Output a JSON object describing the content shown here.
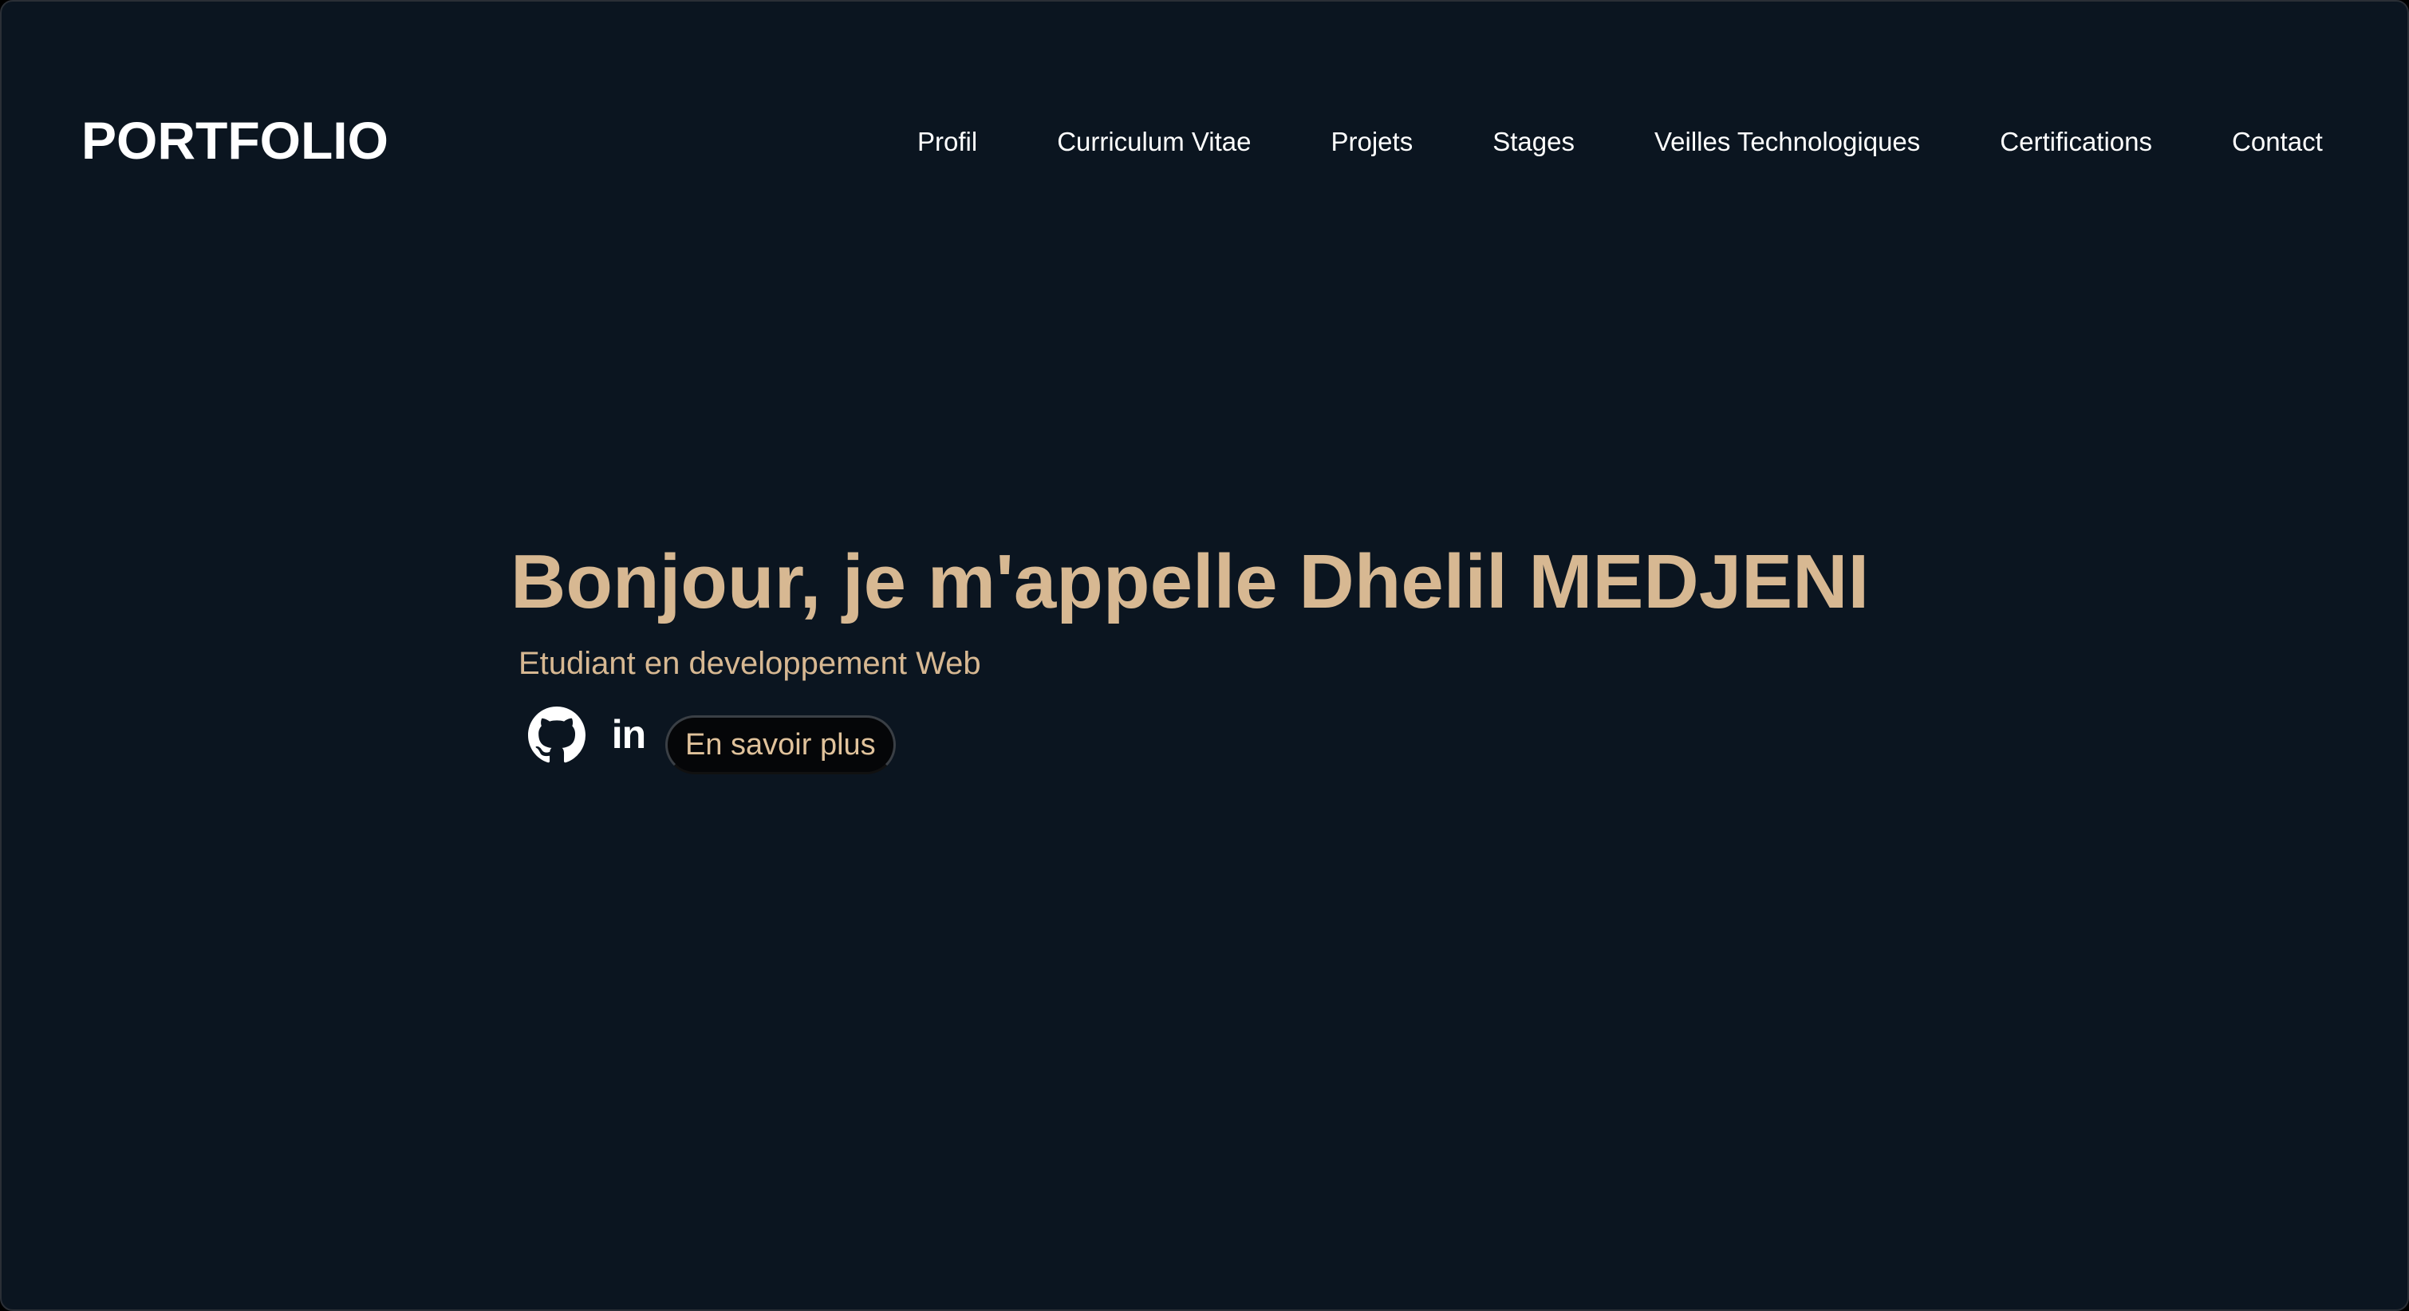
{
  "header": {
    "brand": "PORTFOLIO",
    "nav": [
      {
        "label": "Profil"
      },
      {
        "label": "Curriculum Vitae"
      },
      {
        "label": "Projets"
      },
      {
        "label": "Stages"
      },
      {
        "label": "Veilles Technologiques"
      },
      {
        "label": "Certifications"
      },
      {
        "label": "Contact"
      }
    ]
  },
  "hero": {
    "title": "Bonjour, je m'appelle Dhelil MEDJENI",
    "subtitle": "Etudiant en developpement Web",
    "linkedin_glyph": "in",
    "cta_label": "En savoir plus"
  },
  "icons": {
    "github": "github-icon",
    "linkedin": "linkedin-icon"
  },
  "colors": {
    "background": "#0b1520",
    "accent": "#d7b892",
    "text": "#ffffff",
    "button_bg": "#050608"
  }
}
